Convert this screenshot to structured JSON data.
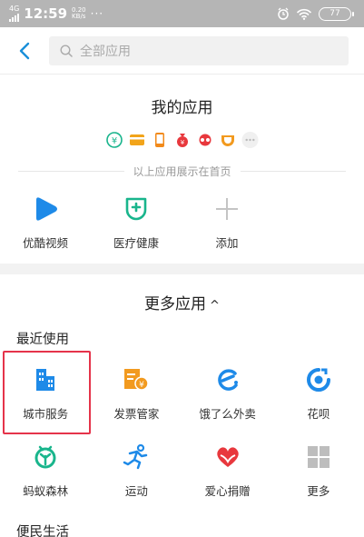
{
  "status_bar": {
    "network": "4G",
    "time": "12:59",
    "speed_value": "0.20",
    "speed_unit": "KB/s",
    "dots": "···",
    "battery": "77"
  },
  "header": {
    "search_placeholder": "全部应用"
  },
  "my_apps": {
    "title": "我的应用",
    "home_note": "以上应用展示在首页",
    "mini_icons": [
      "yuebao-icon",
      "card-icon",
      "phone-icon",
      "money-bag-icon",
      "glasses-icon",
      "cup-icon",
      "more-dots-icon"
    ],
    "items": [
      {
        "label": "优酷视频",
        "icon": "youku-icon",
        "color": "#1e8ae8"
      },
      {
        "label": "医疗健康",
        "icon": "medical-shield-icon",
        "color": "#19b58c"
      },
      {
        "label": "添加",
        "icon": "plus-icon",
        "color": "#c4c4c4"
      }
    ]
  },
  "more_apps": {
    "title": "更多应用",
    "caret": "^",
    "recent_title": "最近使用",
    "row1": [
      {
        "label": "城市服务",
        "icon": "city-building-icon",
        "color": "#1e8ae8"
      },
      {
        "label": "发票管家",
        "icon": "invoice-icon",
        "color": "#f29a1f"
      },
      {
        "label": "饿了么外卖",
        "icon": "eleme-icon",
        "color": "#1e8ae8"
      },
      {
        "label": "花呗",
        "icon": "huabei-icon",
        "color": "#1e8ae8"
      }
    ],
    "row2": [
      {
        "label": "蚂蚁森林",
        "icon": "ant-forest-icon",
        "color": "#19b58c"
      },
      {
        "label": "运动",
        "icon": "runner-icon",
        "color": "#1e8ae8"
      },
      {
        "label": "爱心捐赠",
        "icon": "heart-donate-icon",
        "color": "#e8383d"
      },
      {
        "label": "更多",
        "icon": "grid-more-icon",
        "color": "#bdbdbd"
      }
    ],
    "life_title": "便民生活"
  },
  "highlight_color": "#e5334a"
}
